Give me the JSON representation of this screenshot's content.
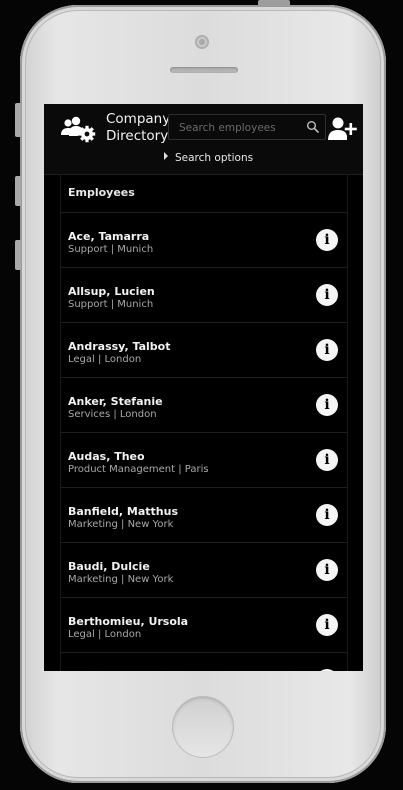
{
  "app": {
    "title_line1": "Company",
    "title_line2": "Directory"
  },
  "search": {
    "placeholder": "Search employees",
    "value": "",
    "options_label": "Search options"
  },
  "list": {
    "section_header": "Employees",
    "info_glyph": "i",
    "employees": [
      {
        "name": "Ace, Tamarra",
        "subtitle": "Support | Munich"
      },
      {
        "name": "Allsup, Lucien",
        "subtitle": "Support | Munich"
      },
      {
        "name": "Andrassy, Talbot",
        "subtitle": "Legal | London"
      },
      {
        "name": "Anker, Stefanie",
        "subtitle": "Services | London"
      },
      {
        "name": "Audas, Theo",
        "subtitle": "Product Management | Paris"
      },
      {
        "name": "Banfield, Matthus",
        "subtitle": "Marketing | New York"
      },
      {
        "name": "Baudi, Dulcie",
        "subtitle": "Marketing | New York"
      },
      {
        "name": "Berthomieu, Ursola",
        "subtitle": "Legal | London"
      },
      {
        "name": "",
        "subtitle": ""
      }
    ]
  },
  "icons": {
    "logo": "users-gear-icon",
    "search": "search-icon",
    "add_user": "add-user-icon",
    "info": "info-circle-icon",
    "expand": "caret-right-icon"
  },
  "colors": {
    "screen_bg": "#000000",
    "text": "#f2f2f2",
    "muted": "#a8a8a8",
    "divider": "#1e1e1e",
    "phone_body": "#dcdcdc"
  }
}
